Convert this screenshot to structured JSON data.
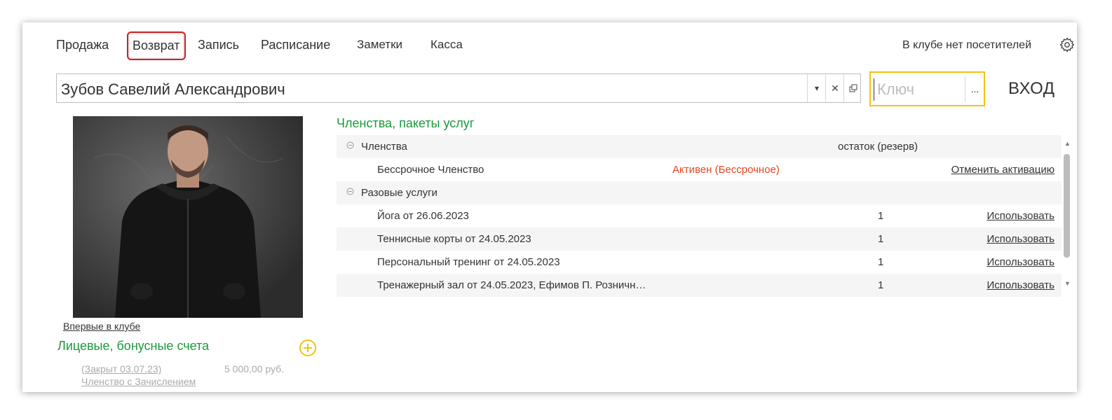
{
  "menu": {
    "items": [
      {
        "label": "Продажа"
      },
      {
        "label": "Возврат"
      },
      {
        "label": "Запись"
      },
      {
        "label": "Расписание"
      },
      {
        "label": "Заметки"
      },
      {
        "label": "Касса"
      }
    ],
    "visitors_status": "В клубе нет посетителей"
  },
  "client": {
    "name": "Зубов Савелий Александрович",
    "first_visit_link": "Впервые в клубе"
  },
  "key_field": {
    "placeholder": "Ключ",
    "dots": "..."
  },
  "enter_button": "ВХОД",
  "accounts": {
    "title": "Лицевые, бонусные счета",
    "items": [
      {
        "status": "(Закрыт 03.07.23)",
        "amount": "5 000,00 руб.",
        "name": "Членство с Зачислением"
      }
    ]
  },
  "memberships": {
    "title": "Членства, пакеты услуг",
    "groups": [
      {
        "name": "Членства",
        "header_note": "остаток (резерв)",
        "rows": [
          {
            "name": "Бессрочное Членство",
            "status": "Активен (Бессрочное)",
            "action": "Отменить активацию"
          }
        ]
      },
      {
        "name": "Разовые услуги",
        "rows": [
          {
            "name": "Йога от 26.06.2023",
            "count": "1",
            "action": "Использовать"
          },
          {
            "name": "Теннисные корты от 24.05.2023",
            "count": "1",
            "action": "Использовать"
          },
          {
            "name": "Персональный тренинг от 24.05.2023",
            "count": "1",
            "action": "Использовать"
          },
          {
            "name": "Тренажерный зал от 24.05.2023, Ефимов  П. Розничн…",
            "count": "1",
            "action": "Использовать"
          }
        ]
      }
    ]
  },
  "colors": {
    "accent_green": "#1a9a3a",
    "status_orange": "#e8441e",
    "highlight_red": "#d21e1e",
    "key_border_yellow": "#f4c20d"
  }
}
